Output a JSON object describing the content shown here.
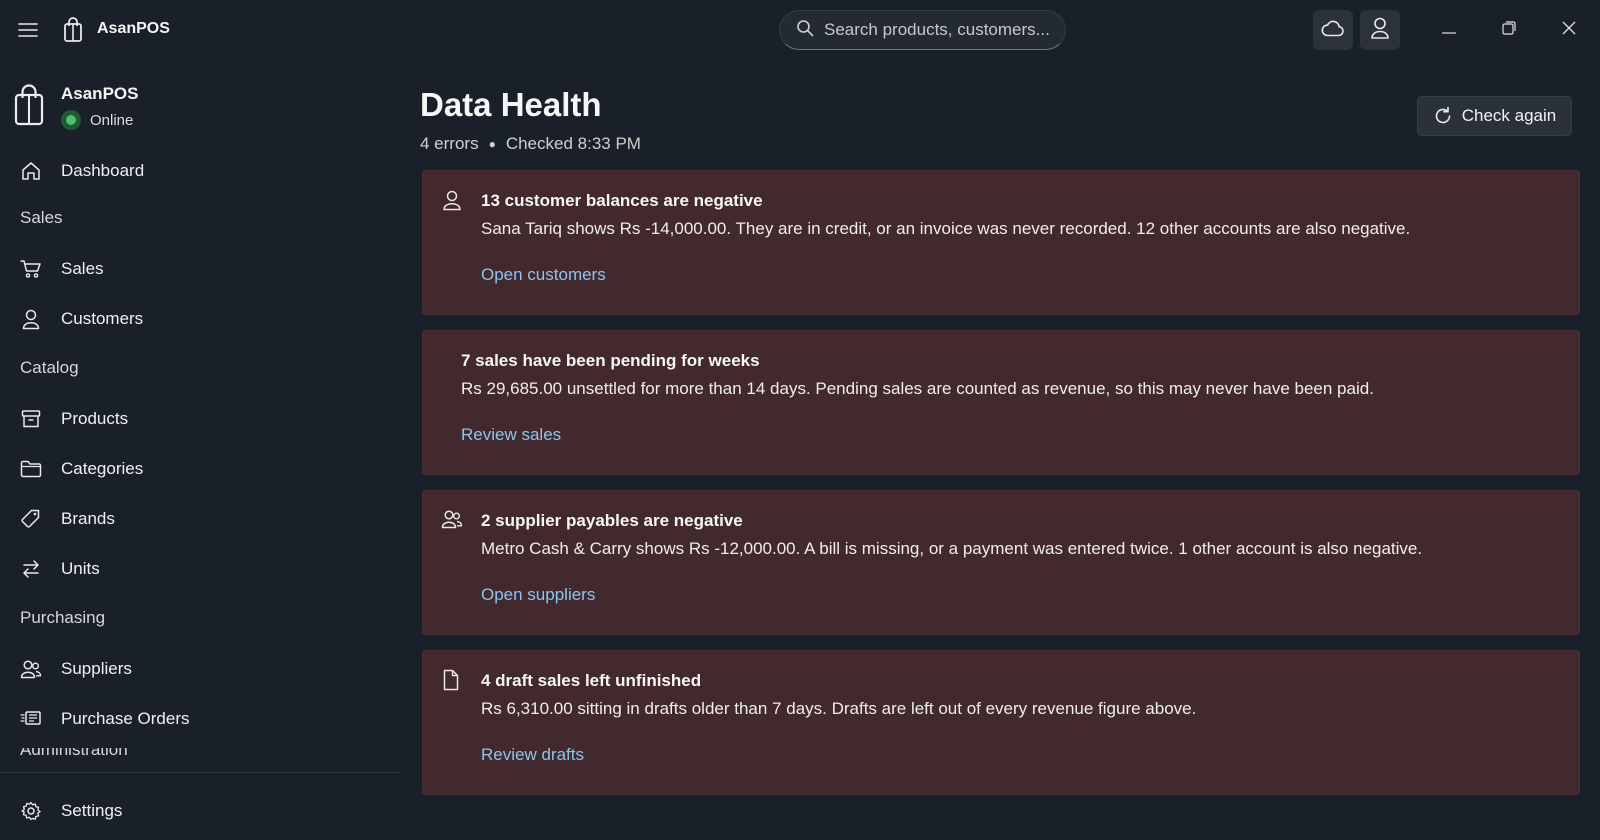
{
  "app": {
    "name": "AsanPOS"
  },
  "search": {
    "placeholder": "Search products, customers..."
  },
  "sidebar": {
    "brand_name": "AsanPOS",
    "status": "Online",
    "dashboard": "Dashboard",
    "sections": {
      "sales": "Sales",
      "catalog": "Catalog",
      "purchasing": "Purchasing",
      "administration": "Administration"
    },
    "items": {
      "sales": "Sales",
      "customers": "Customers",
      "products": "Products",
      "categories": "Categories",
      "brands": "Brands",
      "units": "Units",
      "suppliers": "Suppliers",
      "purchase_orders": "Purchase Orders",
      "settings": "Settings"
    }
  },
  "page": {
    "title": "Data Health",
    "errors": "4 errors",
    "checked": "Checked 8:33 PM",
    "check_again": "Check again"
  },
  "issues": [
    {
      "icon": "person-icon",
      "title": "13 customer balances are negative",
      "body": "Sana Tariq shows Rs -14,000.00. They are in credit, or an invoice was never recorded. 12 other accounts are also negative.",
      "link": "Open customers"
    },
    {
      "icon": "",
      "title": "7 sales have been pending for weeks",
      "body": "Rs 29,685.00 unsettled for more than 14 days. Pending sales are counted as revenue, so this may never have been paid.",
      "link": "Review sales"
    },
    {
      "icon": "people-icon",
      "title": "2 supplier payables are negative",
      "body": "Metro Cash & Carry shows Rs -12,000.00. A bill is missing, or a payment was entered twice. 1 other account is also negative.",
      "link": "Open suppliers"
    },
    {
      "icon": "document-icon",
      "title": "4 draft sales left unfinished",
      "body": "Rs 6,310.00 sitting in drafts older than 7 days. Drafts are left out of every revenue figure above.",
      "link": "Review drafts"
    }
  ],
  "colors": {
    "background": "#1a2029",
    "card": "#42292d",
    "link": "#8cc4f0",
    "online": "#4cc16d"
  }
}
